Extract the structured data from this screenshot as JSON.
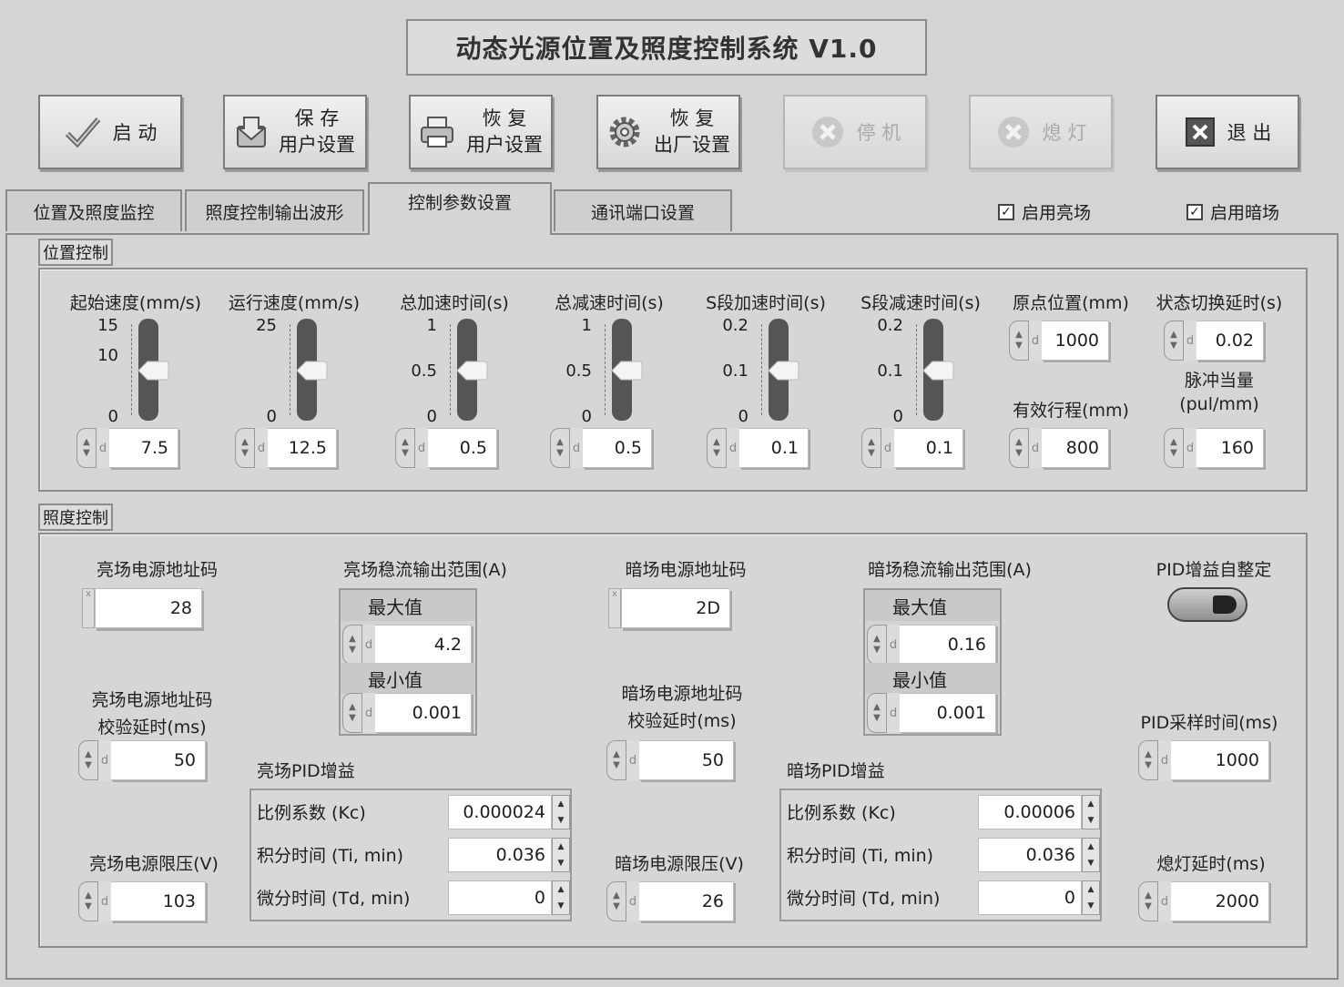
{
  "title": "动态光源位置及照度控制系统 V1.0",
  "toolbar": {
    "start": "启 动",
    "save_line1": "保 存",
    "save_line2": "用户设置",
    "restore_user_line1": "恢 复",
    "restore_user_line2": "用户设置",
    "restore_factory_line1": "恢 复",
    "restore_factory_line2": "出厂设置",
    "stop": "停 机",
    "lamp_off": "熄 灯",
    "exit": "退 出"
  },
  "tabs": [
    "位置及照度监控",
    "照度控制输出波形",
    "控制参数设置",
    "通讯端口设置"
  ],
  "active_tab": 2,
  "checks": {
    "bright": {
      "label": "启用亮场",
      "checked": true
    },
    "dark": {
      "label": "启用暗场",
      "checked": true
    }
  },
  "position": {
    "section_label": "位置控制",
    "sliders": [
      {
        "label": "起始速度(mm/s)",
        "ticks": [
          "15",
          "10",
          "0"
        ],
        "max": 15,
        "value_num": 7.5,
        "value": "7.5"
      },
      {
        "label": "运行速度(mm/s)",
        "ticks": [
          "25",
          "0"
        ],
        "max": 25,
        "value_num": 12.5,
        "value": "12.5"
      },
      {
        "label": "总加速时间(s)",
        "ticks": [
          "1",
          "0.5",
          "0"
        ],
        "max": 1,
        "value_num": 0.5,
        "value": "0.5"
      },
      {
        "label": "总减速时间(s)",
        "ticks": [
          "1",
          "0.5",
          "0"
        ],
        "max": 1,
        "value_num": 0.5,
        "value": "0.5"
      },
      {
        "label": "S段加速时间(s)",
        "ticks": [
          "0.2",
          "0.1",
          "0"
        ],
        "max": 0.2,
        "value_num": 0.1,
        "value": "0.1"
      },
      {
        "label": "S段减速时间(s)",
        "ticks": [
          "0.2",
          "0.1",
          "0"
        ],
        "max": 0.2,
        "value_num": 0.1,
        "value": "0.1"
      }
    ],
    "origin": {
      "label": "原点位置(mm)",
      "value": "1000"
    },
    "stroke": {
      "label": "有效行程(mm)",
      "value": "800"
    },
    "switch_delay": {
      "label": "状态切换延时(s)",
      "value": "0.02"
    },
    "pulse": {
      "label1": "脉冲当量",
      "label2": "(pul/mm)",
      "value": "160"
    }
  },
  "illumination": {
    "section_label": "照度控制",
    "bright_addr": {
      "label": "亮场电源地址码",
      "value": "28"
    },
    "bright_check_delay": {
      "label1": "亮场电源地址码",
      "label2": "校验延时(ms)",
      "value": "50"
    },
    "bright_limit_v": {
      "label": "亮场电源限压(V)",
      "value": "103"
    },
    "bright_range": {
      "label": "亮场稳流输出范围(A)",
      "max_label": "最大值",
      "max": "4.2",
      "min_label": "最小值",
      "min": "0.001"
    },
    "bright_pid": {
      "label": "亮场PID增益",
      "kc_label": "比例系数 (Kc)",
      "kc": "0.000024",
      "ti_label": "积分时间 (Ti, min)",
      "ti": "0.036",
      "td_label": "微分时间 (Td, min)",
      "td": "0"
    },
    "dark_addr": {
      "label": "暗场电源地址码",
      "value": "2D"
    },
    "dark_check_delay": {
      "label1": "暗场电源地址码",
      "label2": "校验延时(ms)",
      "value": "50"
    },
    "dark_limit_v": {
      "label": "暗场电源限压(V)",
      "value": "26"
    },
    "dark_range": {
      "label": "暗场稳流输出范围(A)",
      "max_label": "最大值",
      "max": "0.16",
      "min_label": "最小值",
      "min": "0.001"
    },
    "dark_pid": {
      "label": "暗场PID增益",
      "kc_label": "比例系数 (Kc)",
      "kc": "0.00006",
      "ti_label": "积分时间 (Ti, min)",
      "ti": "0.036",
      "td_label": "微分时间 (Td, min)",
      "td": "0"
    },
    "pid_auto": {
      "label": "PID增益自整定"
    },
    "pid_sample": {
      "label": "PID采样时间(ms)",
      "value": "1000"
    },
    "lamp_delay": {
      "label": "熄灯延时(ms)",
      "value": "2000"
    }
  },
  "icons": {
    "start": "checkmark-icon",
    "save": "save-disk-icon",
    "restore_user": "printer-icon",
    "restore_factory": "gear-icon",
    "stop": "x-circle-icon",
    "lamp_off": "x-circle-icon",
    "exit": "x-box-icon"
  }
}
